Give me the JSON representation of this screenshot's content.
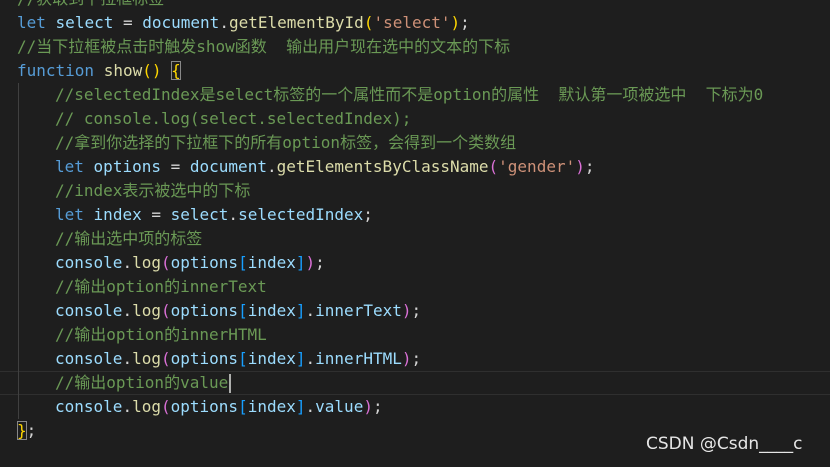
{
  "colors": {
    "background": "#1e1e1e",
    "comment": "#6a9955",
    "keyword": "#569cd6",
    "variable": "#9cdcfe",
    "string": "#ce9178",
    "function": "#dcdcaa",
    "text": "#d4d4d4",
    "bracket_level1": "#ffd700",
    "bracket_level2": "#da70d6",
    "bracket_level3": "#179fff"
  },
  "code_lines": [
    {
      "indent": 0,
      "tokens": [
        {
          "t": "comment",
          "v": "//获取到下拉框标签"
        }
      ]
    },
    {
      "indent": 0,
      "tokens": [
        {
          "t": "keyword",
          "v": "let"
        },
        {
          "t": "text",
          "v": " "
        },
        {
          "t": "var",
          "v": "select"
        },
        {
          "t": "text",
          "v": " = "
        },
        {
          "t": "var",
          "v": "document"
        },
        {
          "t": "text",
          "v": "."
        },
        {
          "t": "func",
          "v": "getElementById"
        },
        {
          "t": "bracket-gold",
          "v": "("
        },
        {
          "t": "string",
          "v": "'select'"
        },
        {
          "t": "bracket-gold",
          "v": ")"
        },
        {
          "t": "text",
          "v": ";"
        }
      ]
    },
    {
      "indent": 0,
      "tokens": [
        {
          "t": "comment",
          "v": "//当下拉框被点击时触发show函数  输出用户现在选中的文本的下标"
        }
      ]
    },
    {
      "indent": 0,
      "tokens": [
        {
          "t": "keyword",
          "v": "function"
        },
        {
          "t": "text",
          "v": " "
        },
        {
          "t": "func",
          "v": "show"
        },
        {
          "t": "bracket-gold",
          "v": "("
        },
        {
          "t": "bracket-gold",
          "v": ")"
        },
        {
          "t": "text",
          "v": " "
        },
        {
          "t": "bracket-gold-match",
          "v": "{"
        }
      ]
    },
    {
      "indent": 1,
      "tokens": [
        {
          "t": "comment",
          "v": "//selectedIndex是select标签的一个属性而不是option的属性  默认第一项被选中  下标为0"
        }
      ]
    },
    {
      "indent": 1,
      "tokens": [
        {
          "t": "comment",
          "v": "// console.log(select.selectedIndex);"
        }
      ]
    },
    {
      "indent": 1,
      "tokens": [
        {
          "t": "comment",
          "v": "//拿到你选择的下拉框下的所有option标签，会得到一个类数组"
        }
      ]
    },
    {
      "indent": 1,
      "tokens": [
        {
          "t": "keyword",
          "v": "let"
        },
        {
          "t": "text",
          "v": " "
        },
        {
          "t": "var",
          "v": "options"
        },
        {
          "t": "text",
          "v": " = "
        },
        {
          "t": "var",
          "v": "document"
        },
        {
          "t": "text",
          "v": "."
        },
        {
          "t": "func",
          "v": "getElementsByClassName"
        },
        {
          "t": "bracket-pink",
          "v": "("
        },
        {
          "t": "string",
          "v": "'gender'"
        },
        {
          "t": "bracket-pink",
          "v": ")"
        },
        {
          "t": "text",
          "v": ";"
        }
      ]
    },
    {
      "indent": 1,
      "tokens": [
        {
          "t": "comment",
          "v": "//index表示被选中的下标"
        }
      ]
    },
    {
      "indent": 1,
      "tokens": [
        {
          "t": "keyword",
          "v": "let"
        },
        {
          "t": "text",
          "v": " "
        },
        {
          "t": "var",
          "v": "index"
        },
        {
          "t": "text",
          "v": " = "
        },
        {
          "t": "var",
          "v": "select"
        },
        {
          "t": "text",
          "v": "."
        },
        {
          "t": "var",
          "v": "selectedIndex"
        },
        {
          "t": "text",
          "v": ";"
        }
      ]
    },
    {
      "indent": 1,
      "tokens": [
        {
          "t": "comment",
          "v": "//输出选中项的标签"
        }
      ]
    },
    {
      "indent": 1,
      "tokens": [
        {
          "t": "var",
          "v": "console"
        },
        {
          "t": "text",
          "v": "."
        },
        {
          "t": "func",
          "v": "log"
        },
        {
          "t": "bracket-pink",
          "v": "("
        },
        {
          "t": "var",
          "v": "options"
        },
        {
          "t": "bracket-blue",
          "v": "["
        },
        {
          "t": "var",
          "v": "index"
        },
        {
          "t": "bracket-blue",
          "v": "]"
        },
        {
          "t": "bracket-pink",
          "v": ")"
        },
        {
          "t": "text",
          "v": ";"
        }
      ]
    },
    {
      "indent": 1,
      "tokens": [
        {
          "t": "comment",
          "v": "//输出option的innerText"
        }
      ]
    },
    {
      "indent": 1,
      "tokens": [
        {
          "t": "var",
          "v": "console"
        },
        {
          "t": "text",
          "v": "."
        },
        {
          "t": "func",
          "v": "log"
        },
        {
          "t": "bracket-pink",
          "v": "("
        },
        {
          "t": "var",
          "v": "options"
        },
        {
          "t": "bracket-blue",
          "v": "["
        },
        {
          "t": "var",
          "v": "index"
        },
        {
          "t": "bracket-blue",
          "v": "]"
        },
        {
          "t": "text",
          "v": "."
        },
        {
          "t": "var",
          "v": "innerText"
        },
        {
          "t": "bracket-pink",
          "v": ")"
        },
        {
          "t": "text",
          "v": ";"
        }
      ]
    },
    {
      "indent": 1,
      "tokens": [
        {
          "t": "comment",
          "v": "//输出option的innerHTML"
        }
      ]
    },
    {
      "indent": 1,
      "tokens": [
        {
          "t": "var",
          "v": "console"
        },
        {
          "t": "text",
          "v": "."
        },
        {
          "t": "func",
          "v": "log"
        },
        {
          "t": "bracket-pink",
          "v": "("
        },
        {
          "t": "var",
          "v": "options"
        },
        {
          "t": "bracket-blue",
          "v": "["
        },
        {
          "t": "var",
          "v": "index"
        },
        {
          "t": "bracket-blue",
          "v": "]"
        },
        {
          "t": "text",
          "v": "."
        },
        {
          "t": "var",
          "v": "innerHTML"
        },
        {
          "t": "bracket-pink",
          "v": ")"
        },
        {
          "t": "text",
          "v": ";"
        }
      ]
    },
    {
      "indent": 1,
      "current": true,
      "caret": true,
      "tokens": [
        {
          "t": "comment",
          "v": "//输出option的value"
        }
      ]
    },
    {
      "indent": 1,
      "tokens": [
        {
          "t": "var",
          "v": "console"
        },
        {
          "t": "text",
          "v": "."
        },
        {
          "t": "func",
          "v": "log"
        },
        {
          "t": "bracket-pink",
          "v": "("
        },
        {
          "t": "var",
          "v": "options"
        },
        {
          "t": "bracket-blue",
          "v": "["
        },
        {
          "t": "var",
          "v": "index"
        },
        {
          "t": "bracket-blue",
          "v": "]"
        },
        {
          "t": "text",
          "v": "."
        },
        {
          "t": "var",
          "v": "value"
        },
        {
          "t": "bracket-pink",
          "v": ")"
        },
        {
          "t": "text",
          "v": ";"
        }
      ]
    },
    {
      "indent": 0,
      "tokens": [
        {
          "t": "bracket-gold-match",
          "v": "}"
        },
        {
          "t": "text",
          "v": ";"
        }
      ]
    }
  ],
  "watermark": "CSDN @Csdn____c"
}
